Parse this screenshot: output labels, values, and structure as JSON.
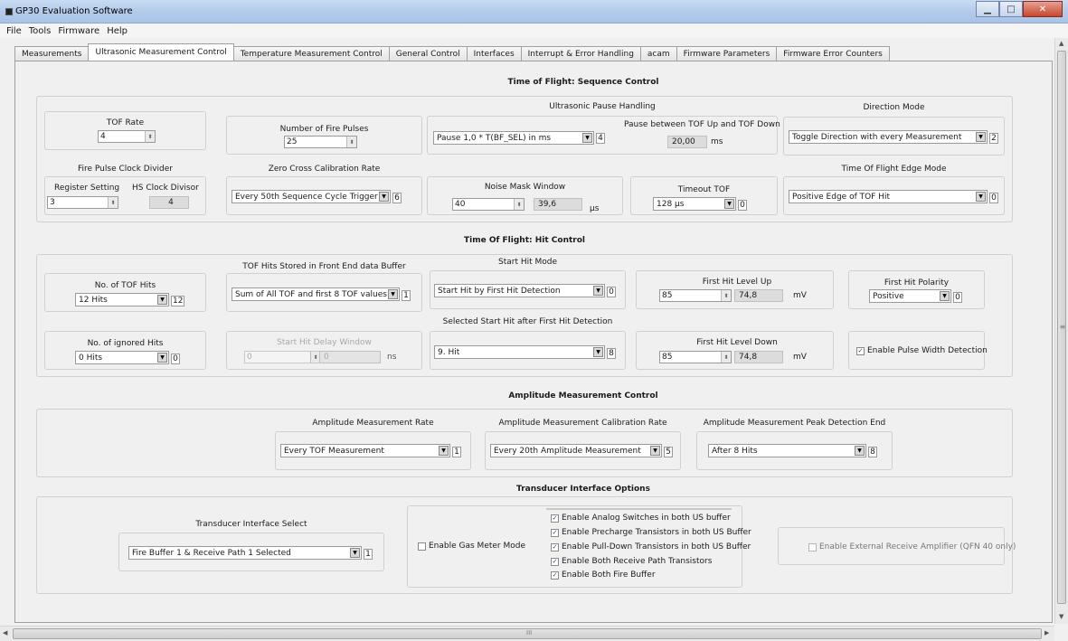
{
  "window": {
    "title": "GP30 Evaluation Software",
    "buttons": {
      "minimize": "▁",
      "maximize": "□",
      "close": "✕"
    }
  },
  "menu": [
    "File",
    "Tools",
    "Firmware",
    "Help"
  ],
  "tabs": [
    "Measurements",
    "Ultrasonic Measurement Control",
    "Temperature Measurement Control",
    "General Control",
    "Interfaces",
    "Interrupt & Error Handling",
    "acam",
    "Firmware Parameters",
    "Firmware Error Counters"
  ],
  "active_tab": "Ultrasonic Measurement Control",
  "tof_seq": {
    "title": "Time of Flight: Sequence Control",
    "tof_rate": {
      "label": "TOF Rate",
      "value": "4"
    },
    "fire_pulses": {
      "label": "Number of Fire Pulses",
      "value": "25"
    },
    "pause": {
      "title": "Ultrasonic Pause Handling",
      "combo": "Pause 1,0 * T(BF_SEL) in ms",
      "index": "4",
      "between_label": "Pause between TOF Up and TOF Down",
      "between_value": "20,00",
      "unit": "ms"
    },
    "direction": {
      "title": "Direction Mode",
      "combo": "Toggle Direction with every Measurement",
      "index": "2"
    },
    "fire_clock": {
      "title": "Fire Pulse Clock Divider",
      "reg_label": "Register Setting",
      "reg_value": "3",
      "hs_label": "HS Clock Divisor",
      "hs_value": "4"
    },
    "zero_cross": {
      "title": "Zero Cross Calibration Rate",
      "combo": "Every 50th Sequence Cycle Trigger",
      "index": "6"
    },
    "noise_mask": {
      "label": "Noise Mask Window",
      "value": "40",
      "calc": "39,6",
      "unit": "µs"
    },
    "timeout": {
      "label": "Timeout TOF",
      "combo": "128 µs",
      "index": "0"
    },
    "edge_mode": {
      "title": "Time Of Flight Edge Mode",
      "combo": "Positive Edge of TOF Hit",
      "index": "0"
    }
  },
  "hit": {
    "title": "Time Of Flight: Hit Control",
    "tof_hits": {
      "label": "No. of TOF Hits",
      "combo": "12 Hits",
      "index": "12"
    },
    "stored": {
      "title": "TOF Hits Stored in Front End data Buffer",
      "combo": "Sum of All TOF and first 8 TOF values",
      "index": "1"
    },
    "start_mode": {
      "title": "Start Hit Mode",
      "combo": "Start Hit by First Hit Detection",
      "index": "0"
    },
    "level_up": {
      "label": "First Hit Level Up",
      "value": "85",
      "calc": "74,8",
      "unit": "mV"
    },
    "polarity": {
      "label": "First Hit Polarity",
      "combo": "Positive",
      "index": "0"
    },
    "ignored": {
      "label": "No. of ignored Hits",
      "combo": "0 Hits",
      "index": "0"
    },
    "delay": {
      "label": "Start Hit Delay Window",
      "value": "0",
      "calc": "0",
      "unit": "ns"
    },
    "selected_start": {
      "title": "Selected Start Hit after First Hit Detection",
      "combo": "9. Hit",
      "index": "8"
    },
    "level_down": {
      "label": "First Hit Level Down",
      "value": "85",
      "calc": "74,8",
      "unit": "mV"
    },
    "pulse_width": {
      "label": "Enable Pulse Width Detection",
      "checked": true
    }
  },
  "amp": {
    "title": "Amplitude Measurement Control",
    "rate": {
      "title": "Amplitude Measurement Rate",
      "combo": "Every TOF Measurement",
      "index": "1"
    },
    "calib": {
      "title": "Amplitude Measurement Calibration Rate",
      "combo": "Every 20th Amplitude Measurement",
      "index": "5"
    },
    "peak": {
      "title": "Amplitude Measurement Peak Detection End",
      "combo": "After 8 Hits",
      "index": "8"
    }
  },
  "trans": {
    "title": "Transducer Interface Options",
    "select": {
      "title": "Transducer Interface Select",
      "combo": "Fire Buffer 1 & Receive Path 1 Selected",
      "index": "1"
    },
    "gas_meter": "Enable Gas Meter Mode",
    "options": [
      "Enable Analog Switches in both US buffer",
      "Enable Precharge Transistors in both US Buffer",
      "Enable Pull-Down Transistors in both US Buffer",
      "Enable Both Receive Path Transistors",
      "Enable Both Fire Buffer"
    ],
    "ext_amp": "Enable External Receive Amplifier (QFN 40 only)"
  },
  "icons": {
    "spin": "spin-arrows-icon",
    "dropdown": "dropdown-arrow-icon",
    "check": "checkmark-icon"
  },
  "scroll": {
    "grip": "III",
    "side_grip": "≡"
  }
}
